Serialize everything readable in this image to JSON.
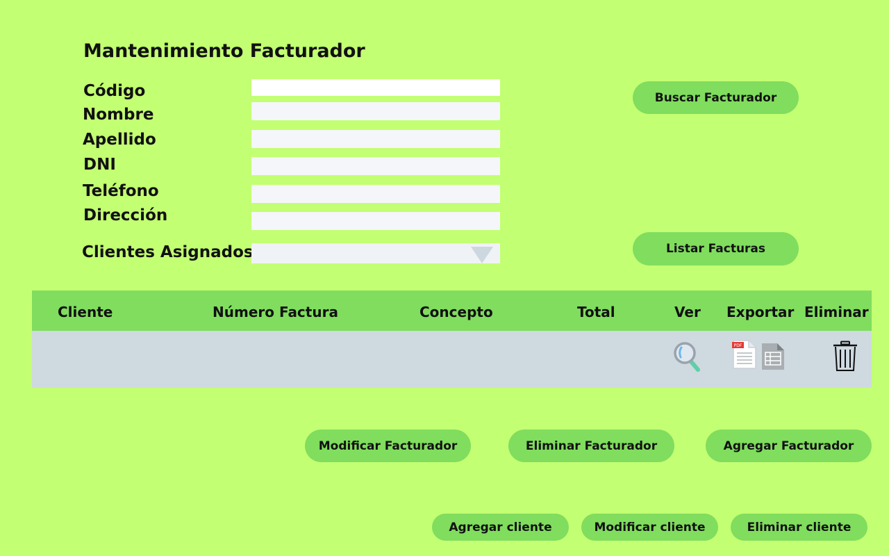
{
  "page": {
    "title": "Mantenimiento Facturador"
  },
  "form": {
    "codigo_label": "Código",
    "nombre_label": "Nombre",
    "apellido_label": "Apellido",
    "dni_label": "DNI",
    "telefono_label": "Teléfono",
    "direccion_label": "Dirección",
    "clientes_label": "Clientes Asignados",
    "codigo_value": "",
    "nombre_value": "",
    "apellido_value": "",
    "dni_value": "",
    "telefono_value": "",
    "direccion_value": "",
    "clientes_selected": ""
  },
  "actions": {
    "buscar": "Buscar Facturador",
    "listar": "Listar Facturas"
  },
  "table": {
    "columns": [
      "Cliente",
      "Número Factura",
      "Concepto",
      "Total",
      "Ver",
      "Exportar",
      "Eliminar"
    ],
    "rows": [
      {
        "cliente": "",
        "numero_factura": "",
        "concepto": "",
        "total": "",
        "icons": [
          "magnifier-icon",
          "pdf-file-icon",
          "spreadsheet-file-icon",
          "trash-icon"
        ]
      }
    ]
  },
  "facturador_buttons": {
    "modificar": "Modificar Facturador",
    "eliminar": "Eliminar Facturador",
    "agregar": "Agregar Facturador"
  },
  "cliente_buttons": {
    "agregar": "Agregar cliente",
    "modificar": "Modificar cliente",
    "eliminar": "Eliminar cliente"
  },
  "colors": {
    "background": "#c3ff72",
    "button": "#80dd5e",
    "table_row": "#cfd9e0",
    "input": "#f4f6f9"
  }
}
